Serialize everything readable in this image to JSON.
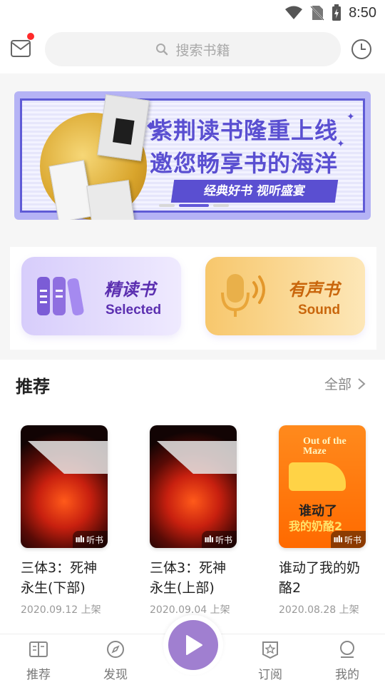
{
  "status_bar": {
    "time": "8:50"
  },
  "search": {
    "placeholder": "搜索书籍"
  },
  "banner": {
    "title_line1": "紫荆读书隆重上线",
    "title_line2": "邀您畅享书的海洋",
    "tagline": "经典好书 视听盛宴"
  },
  "categories": [
    {
      "title": "精读书",
      "subtitle": "Selected",
      "icon": "books-icon"
    },
    {
      "title": "有声书",
      "subtitle": "Sound",
      "icon": "microphone-icon"
    }
  ],
  "recommend": {
    "title": "推荐",
    "all_label": "全部",
    "books": [
      {
        "name": "三体3：死神永生(下部)",
        "date": "2020.09.12 上架",
        "badge": "听书"
      },
      {
        "name": "三体3：死神永生(上部)",
        "date": "2020.09.04 上架",
        "badge": "听书"
      },
      {
        "name": "谁动了我的奶酪2",
        "date": "2020.08.28 上架",
        "badge": "听书",
        "cover_en": "Out of the Maze",
        "cover_cn": "谁动了",
        "cover_cn2": "我的奶酪2"
      }
    ]
  },
  "tabs": [
    {
      "label": "推荐",
      "icon": "book-open-icon"
    },
    {
      "label": "发现",
      "icon": "compass-icon"
    },
    {
      "label": "订阅",
      "icon": "star-badge-icon"
    },
    {
      "label": "我的",
      "icon": "user-icon"
    }
  ],
  "colors": {
    "accent_purple": "#5a4fd1",
    "play_button": "#a07fd0",
    "notification_dot": "#ff2a2a"
  }
}
